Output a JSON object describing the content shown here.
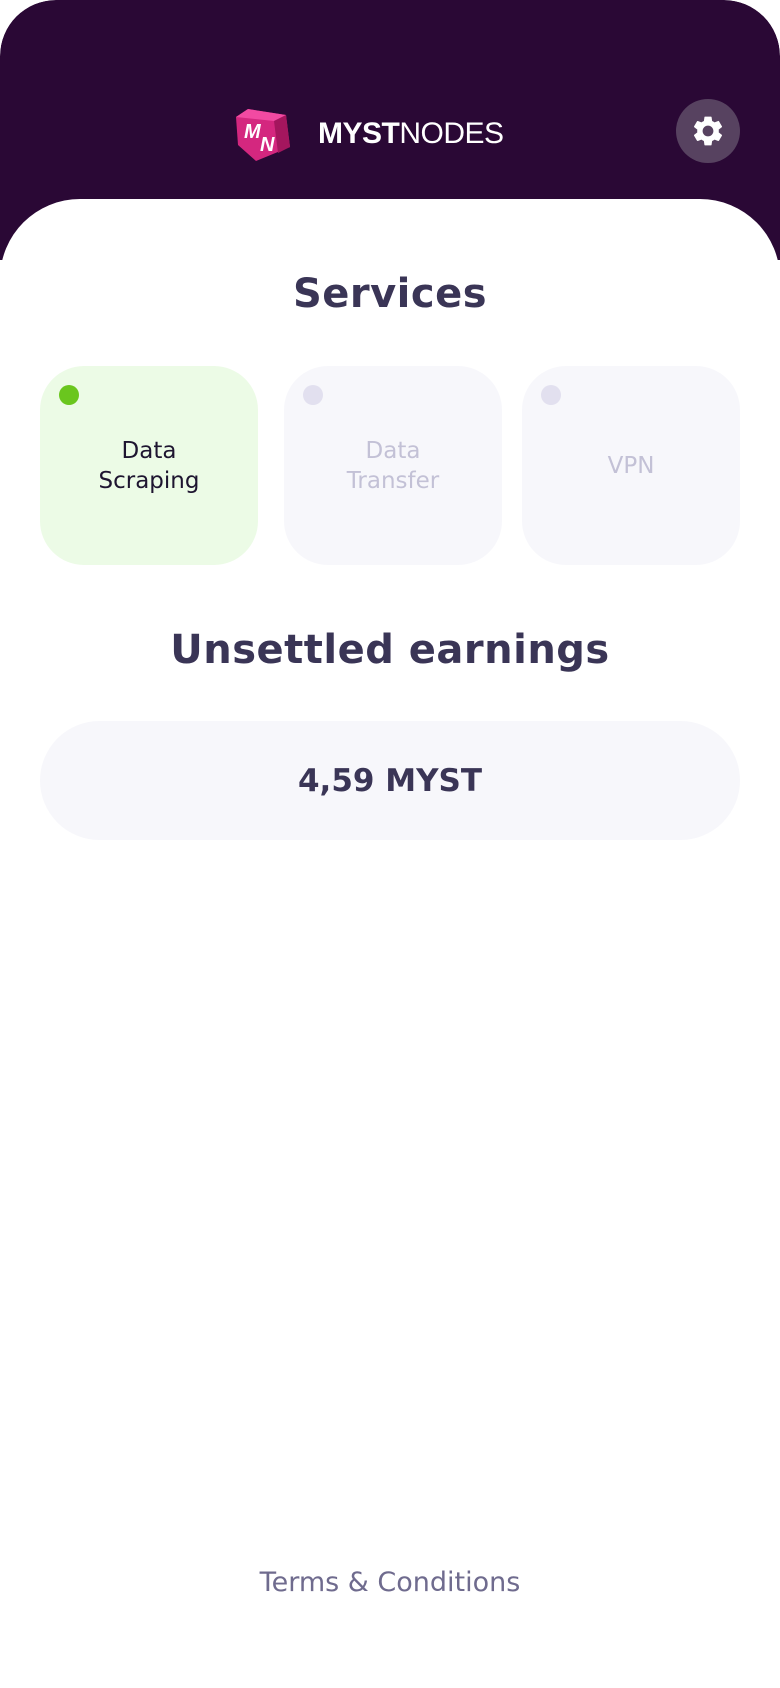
{
  "header": {
    "brand_bold": "MYST",
    "brand_light": "NODES",
    "logo_letters": "MN",
    "settings_icon": "gear-icon",
    "background_color": "#2a0835"
  },
  "services": {
    "title": "Services",
    "cards": [
      {
        "label": "Data Scraping",
        "status": "active",
        "status_color": "#6ac61e"
      },
      {
        "label": "Data Transfer",
        "status": "inactive",
        "status_color": "#e2e0ef"
      },
      {
        "label": "VPN",
        "status": "inactive",
        "status_color": "#e2e0ef"
      }
    ]
  },
  "earnings": {
    "title": "Unsettled earnings",
    "value": "4,59 MYST"
  },
  "footer": {
    "terms_link": "Terms & Conditions"
  }
}
